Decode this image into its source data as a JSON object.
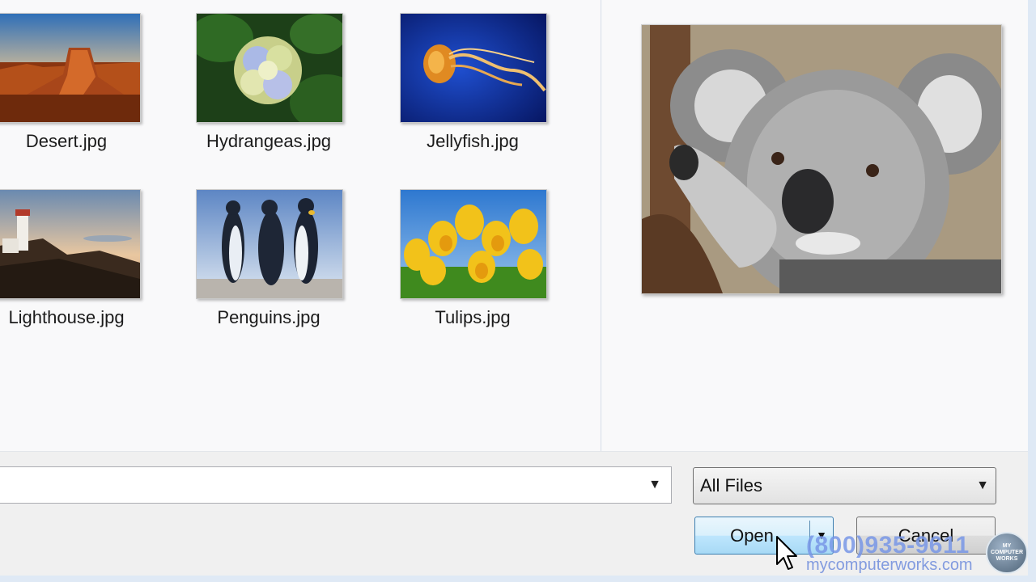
{
  "files": [
    {
      "name": "Desert.jpg",
      "icon": "desert-thumbnail"
    },
    {
      "name": "Hydrangeas.jpg",
      "icon": "hydrangeas-thumbnail"
    },
    {
      "name": "Jellyfish.jpg",
      "icon": "jellyfish-thumbnail"
    },
    {
      "name": "Lighthouse.jpg",
      "icon": "lighthouse-thumbnail"
    },
    {
      "name": "Penguins.jpg",
      "icon": "penguins-thumbnail"
    },
    {
      "name": "Tulips.jpg",
      "icon": "tulips-thumbnail"
    }
  ],
  "preview": {
    "icon": "koala-preview"
  },
  "filename_field": {
    "value": "",
    "placeholder": ""
  },
  "file_type": {
    "selected": "All Files"
  },
  "buttons": {
    "open": "Open",
    "cancel": "Cancel"
  },
  "watermark": {
    "phone": "(800)935-9611",
    "url": "mycomputerworks.com",
    "logo_lines": [
      "MY",
      "COMPUTER",
      "WORKS"
    ]
  },
  "colors": {
    "accent": "#3c7fb1",
    "watermark": "#7896e6"
  }
}
